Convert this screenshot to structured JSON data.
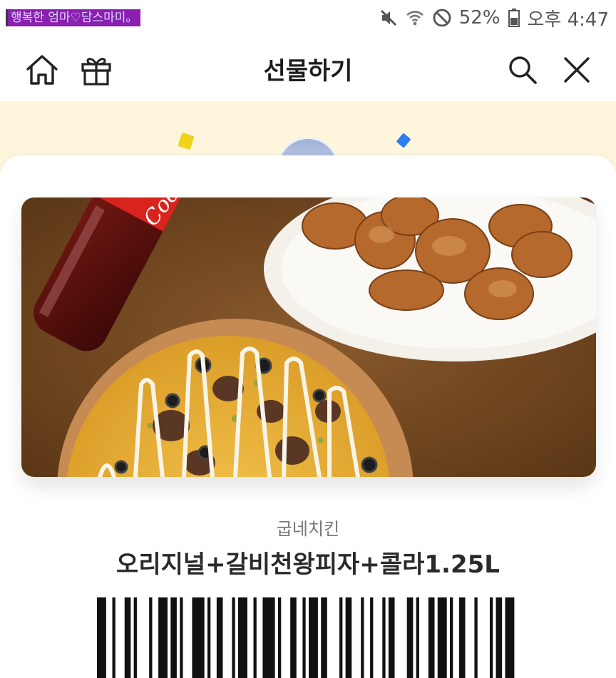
{
  "status_bar": {
    "carrier_label": "행복한 엄마♡담스마미。",
    "battery": "52%",
    "time": "오후 4:47",
    "icons": [
      "mute-icon",
      "wifi-icon",
      "do-not-disturb-icon",
      "battery-icon"
    ]
  },
  "header": {
    "title": "선물하기",
    "left_icons": [
      "home-icon",
      "gift-icon"
    ],
    "right_icons": [
      "search-icon",
      "close-icon"
    ]
  },
  "banner": {
    "background": "#fdf5dc",
    "confetti_colors": [
      "#f2d31b",
      "#2f7df0"
    ]
  },
  "product": {
    "image_label": "Coca-Cola",
    "brand": "굽네치킨",
    "name": "오리지널+갈비천왕피자+콜라1.25L"
  },
  "colors": {
    "accent_text": "#1d1d1d",
    "secondary_text": "#777777"
  }
}
